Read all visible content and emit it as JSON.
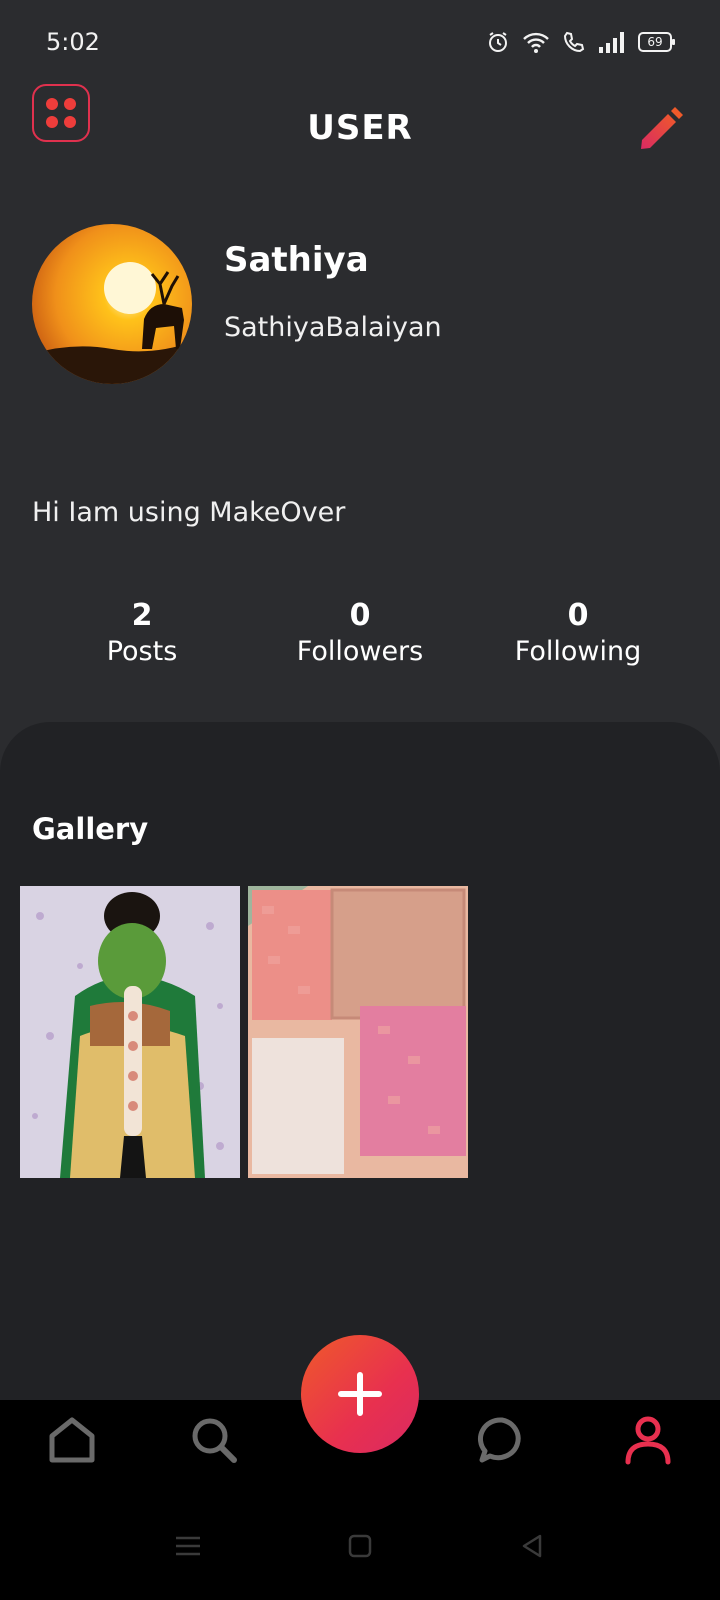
{
  "status_bar": {
    "time": "5:02",
    "battery": "69",
    "icons": [
      "alarm-icon",
      "wifi-icon",
      "wifi-call-icon",
      "signal-icon",
      "battery-icon"
    ]
  },
  "header": {
    "title": "USER",
    "menu_icon": "grid-dots-icon",
    "edit_icon": "pencil-icon"
  },
  "profile": {
    "name": "Sathiya",
    "username": "SathiyaBalaiyan",
    "bio": "Hi Iam using MakeOver"
  },
  "stats": [
    {
      "value": "2",
      "label": "Posts"
    },
    {
      "value": "0",
      "label": "Followers"
    },
    {
      "value": "0",
      "label": "Following"
    }
  ],
  "gallery": {
    "title": "Gallery",
    "items": [
      "bridal-hair-photo",
      "blush-palette-photo"
    ]
  },
  "bottom_nav": {
    "items": [
      "home-icon",
      "search-icon",
      "add-icon",
      "chat-icon",
      "profile-icon"
    ],
    "active": "profile-icon"
  },
  "colors": {
    "background": "#2b2c2f",
    "panel": "#212225",
    "accent": "#e8304f",
    "accent_orange": "#ef5a2a",
    "inactive_icon": "#6a6a6a"
  }
}
